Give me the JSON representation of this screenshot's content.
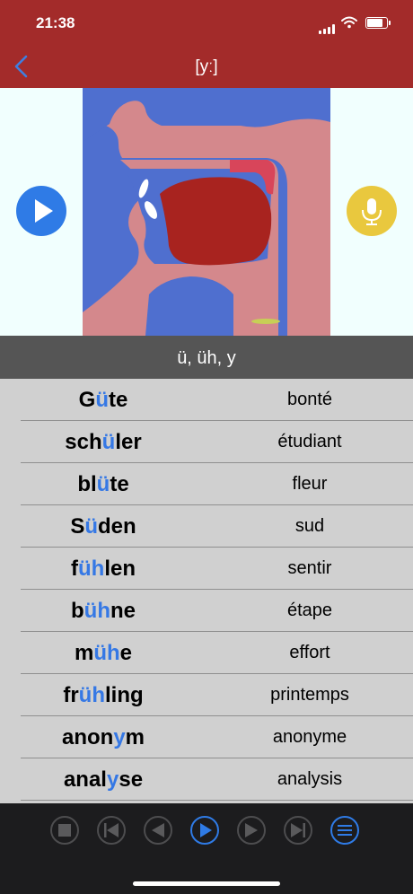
{
  "status_bar": {
    "time": "21:38"
  },
  "nav": {
    "title": "[yː]"
  },
  "spelling": "ü, üh, y",
  "words": [
    {
      "pre": "G",
      "hl": "ü",
      "post": "te",
      "translation": "bonté"
    },
    {
      "pre": "sch",
      "hl": "ü",
      "post": "ler",
      "translation": "étudiant"
    },
    {
      "pre": "bl",
      "hl": "ü",
      "post": "te",
      "translation": "fleur"
    },
    {
      "pre": "S",
      "hl": "ü",
      "post": "den",
      "translation": "sud"
    },
    {
      "pre": "f",
      "hl": "üh",
      "post": "len",
      "translation": "sentir"
    },
    {
      "pre": "b",
      "hl": "üh",
      "post": "ne",
      "translation": "étape"
    },
    {
      "pre": "m",
      "hl": "üh",
      "post": "e",
      "translation": "effort"
    },
    {
      "pre": "fr",
      "hl": "üh",
      "post": "ling",
      "translation": "printemps"
    },
    {
      "pre": "anon",
      "hl": "y",
      "post": "m",
      "translation": "anonyme"
    },
    {
      "pre": "anal",
      "hl": "y",
      "post": "se",
      "translation": "analysis"
    }
  ],
  "toolbar": [
    "stop-icon",
    "skip-first-icon",
    "previous-icon",
    "play-icon",
    "next-icon",
    "skip-last-icon",
    "list-icon"
  ],
  "colors": {
    "header": "#a32b2a",
    "accent": "#3578e5",
    "mic": "#e9c83e"
  }
}
